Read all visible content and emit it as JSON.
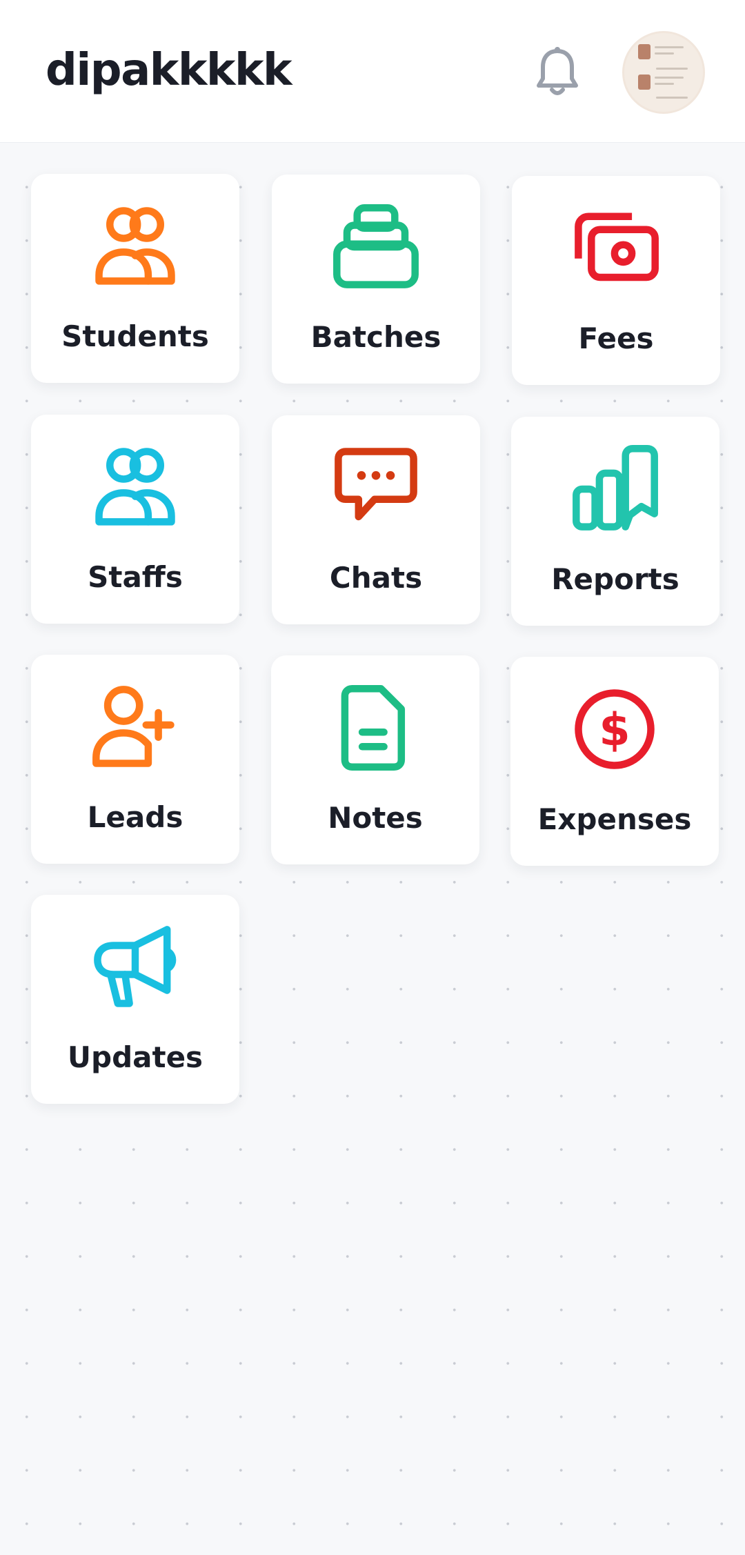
{
  "header": {
    "title": "dipakkkkk",
    "notification_icon": "bell-icon",
    "avatar_icon": "profile-avatar"
  },
  "colors": {
    "orange": "#ff7a1a",
    "green": "#1dbd85",
    "red": "#e81e2c",
    "cyan": "#19bfe0",
    "rust": "#d43b12",
    "teal": "#22c4ad",
    "text": "#1b1e28",
    "background": "#f7f8fa"
  },
  "tiles": [
    {
      "label": "Students",
      "icon": "users-icon",
      "color": "#ff7a1a"
    },
    {
      "label": "Batches",
      "icon": "layers-icon",
      "color": "#1dbd85"
    },
    {
      "label": "Fees",
      "icon": "cash-icon",
      "color": "#e81e2c"
    },
    {
      "label": "Staffs",
      "icon": "users-icon",
      "color": "#19bfe0"
    },
    {
      "label": "Chats",
      "icon": "chat-icon",
      "color": "#d43b12"
    },
    {
      "label": "Reports",
      "icon": "bar-chart-icon",
      "color": "#22c4ad"
    },
    {
      "label": "Leads",
      "icon": "user-plus-icon",
      "color": "#ff7a1a"
    },
    {
      "label": "Notes",
      "icon": "document-icon",
      "color": "#1dbd85"
    },
    {
      "label": "Expenses",
      "icon": "dollar-coin-icon",
      "color": "#e81e2c"
    },
    {
      "label": "Updates",
      "icon": "megaphone-icon",
      "color": "#19bfe0"
    }
  ]
}
